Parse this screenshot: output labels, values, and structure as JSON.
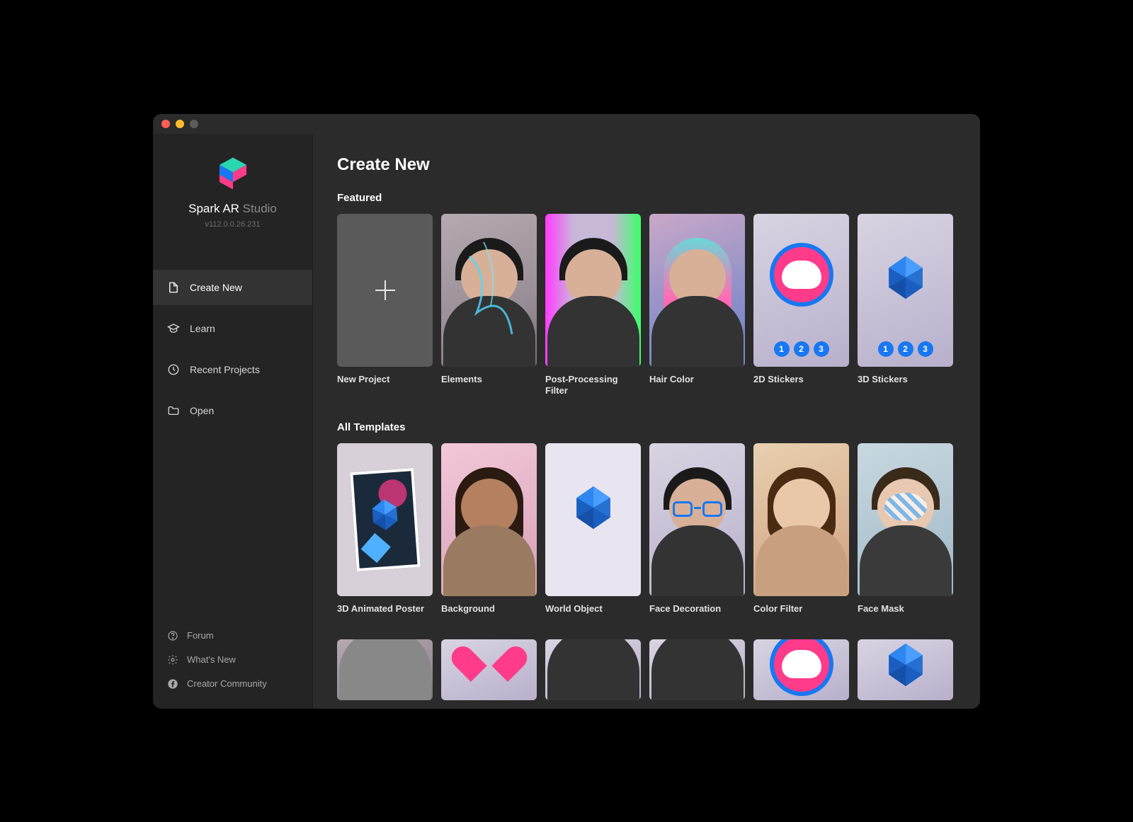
{
  "brand": {
    "name": "Spark AR",
    "suffix": "Studio",
    "version": "v112.0.0.26.231"
  },
  "sidebar": {
    "items": [
      {
        "label": "Create New",
        "icon": "document-icon",
        "active": true
      },
      {
        "label": "Learn",
        "icon": "graduation-icon",
        "active": false
      },
      {
        "label": "Recent Projects",
        "icon": "clock-icon",
        "active": false
      },
      {
        "label": "Open",
        "icon": "folder-icon",
        "active": false
      }
    ],
    "bottom": [
      {
        "label": "Forum",
        "icon": "help-icon"
      },
      {
        "label": "What's New",
        "icon": "gear-icon"
      },
      {
        "label": "Creator Community",
        "icon": "facebook-icon"
      }
    ]
  },
  "page": {
    "title": "Create New",
    "sections": [
      {
        "title": "Featured",
        "cards": [
          {
            "label": "New Project",
            "kind": "blank"
          },
          {
            "label": "Elements",
            "kind": "person-effect"
          },
          {
            "label": "Post-Processing Filter",
            "kind": "person-glitch"
          },
          {
            "label": "Hair Color",
            "kind": "person-rainbow"
          },
          {
            "label": "2D Stickers",
            "kind": "sticker2d",
            "badges": [
              "1",
              "2",
              "3"
            ]
          },
          {
            "label": "3D Stickers",
            "kind": "sticker3d",
            "badges": [
              "1",
              "2",
              "3"
            ]
          }
        ]
      },
      {
        "title": "All Templates",
        "cards": [
          {
            "label": "3D Animated Poster",
            "kind": "poster"
          },
          {
            "label": "Background",
            "kind": "person-bg"
          },
          {
            "label": "World Object",
            "kind": "world-object"
          },
          {
            "label": "Face Decoration",
            "kind": "person-glasses"
          },
          {
            "label": "Color Filter",
            "kind": "person-warm"
          },
          {
            "label": "Face Mask",
            "kind": "person-facepaint"
          }
        ]
      },
      {
        "title": "",
        "partial": true,
        "cards": [
          {
            "label": "",
            "kind": "person-plain"
          },
          {
            "label": "",
            "kind": "heart"
          },
          {
            "label": "",
            "kind": "person-dark"
          },
          {
            "label": "",
            "kind": "person-headband"
          },
          {
            "label": "",
            "kind": "sticker2d"
          },
          {
            "label": "",
            "kind": "icosa-only"
          }
        ]
      }
    ]
  }
}
